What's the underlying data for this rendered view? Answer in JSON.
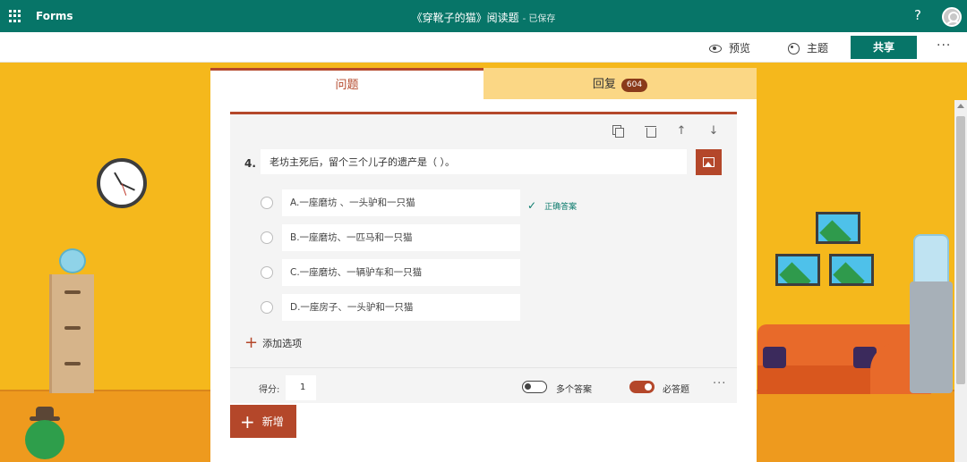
{
  "header": {
    "app_name": "Forms",
    "doc_title": "《穿靴子的猫》阅读题",
    "save_status": "- 已保存",
    "help_glyph": "?"
  },
  "commands": {
    "preview": "预览",
    "theme": "主题",
    "share": "共享",
    "more": "···"
  },
  "tabs": [
    {
      "label": "问题",
      "active": true
    },
    {
      "label": "回复",
      "badge": "604",
      "active": false
    }
  ],
  "question": {
    "number": "4.",
    "text": "老坊主死后，留个三个儿子的遗产是（ ）。",
    "options": [
      {
        "label": "A.一座磨坊 、一头驴和一只猫",
        "correct": true
      },
      {
        "label": "B.一座磨坊、一匹马和一只猫",
        "correct": false
      },
      {
        "label": "C.一座磨坊、一辆驴车和一只猫",
        "correct": false
      },
      {
        "label": "D.一座房子、一头驴和一只猫",
        "correct": false
      }
    ],
    "correct_label": "正确答案",
    "add_option": "添加选项",
    "score_label": "得分:",
    "score_value": "1",
    "multi_answer_label": "多个答案",
    "multi_answer_on": false,
    "required_label": "必答题",
    "required_on": true,
    "more": "···"
  },
  "new_button": "新增",
  "colors": {
    "brand": "#077568",
    "accent": "#b4472a",
    "tab_inactive": "#fbd785",
    "background": "#f5b81c"
  }
}
